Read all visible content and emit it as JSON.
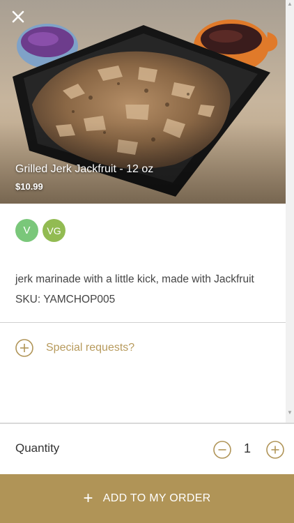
{
  "item": {
    "title": "Grilled Jerk Jackfruit - 12 oz",
    "price": "$10.99",
    "badges": [
      {
        "label": "V",
        "color": "#7ac77a"
      },
      {
        "label": "VG",
        "color": "#92bb52"
      }
    ],
    "description": "jerk marinade with a little kick, made with Jackfruit SKU: YAMCHOP005"
  },
  "special_requests": {
    "label": "Special requests?",
    "icon": "plus-circle-icon"
  },
  "quantity": {
    "label": "Quantity",
    "value": "1",
    "decrement_icon": "minus-circle-icon",
    "increment_icon": "plus-circle-icon"
  },
  "add_button": {
    "label": "ADD TO MY ORDER",
    "icon": "plus-icon"
  },
  "header": {
    "close_icon": "close-icon"
  },
  "colors": {
    "accent": "#b09457",
    "accent_text": "#b79a5c",
    "veg_badge": "#7ac77a",
    "vegan_badge": "#92bb52"
  }
}
